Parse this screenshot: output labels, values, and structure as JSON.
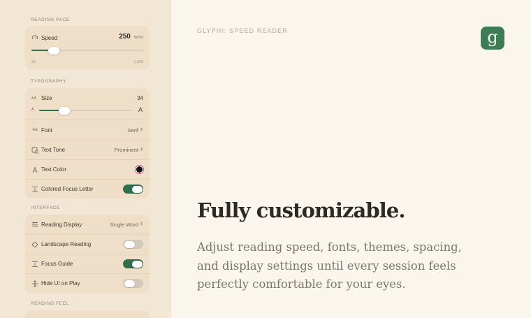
{
  "sidebar": {
    "reading_pace": {
      "section_label": "READING PACE",
      "speed": {
        "label": "Speed",
        "value": "250",
        "unit": "WPM",
        "min_label": "50",
        "max_label": "1,200",
        "level_fraction": 0.2
      }
    },
    "typography": {
      "section_label": "TYPOGRAPHY",
      "size": {
        "label": "Size",
        "value": "34",
        "small_glyph": "A",
        "large_glyph": "A",
        "level_fraction": 0.27
      },
      "font": {
        "label": "Font",
        "value": "Serif"
      },
      "text_tone": {
        "label": "Text Tone",
        "value": "Prominent"
      },
      "text_color": {
        "label": "Text Color",
        "swatch_color": "#111111"
      },
      "colored_focus_letter": {
        "label": "Colored Focus Letter",
        "on": true
      }
    },
    "interface": {
      "section_label": "INTERFACE",
      "reading_display": {
        "label": "Reading Display",
        "value": "Single Word"
      },
      "landscape_reading": {
        "label": "Landscape Reading",
        "on": false
      },
      "focus_guide": {
        "label": "Focus Guide",
        "on": true
      },
      "hide_ui_on_play": {
        "label": "Hide UI on Play",
        "on": false
      }
    },
    "reading_feel": {
      "section_label": "READING FEEL"
    }
  },
  "main": {
    "app_name": "GLYPHI: SPEED READER",
    "app_icon_letter": "g",
    "headline": "Fully customizable.",
    "body": "Adjust reading speed, fonts, themes, spacing, and display settings until every session feels perfectly comfortable for your eyes."
  },
  "colors": {
    "accent": "#2f6f4c",
    "sidebar_bg": "#f2e6d4",
    "card_bg": "#efdfc8",
    "main_bg": "#faf6ee",
    "app_icon_bg": "#3d7c55"
  }
}
